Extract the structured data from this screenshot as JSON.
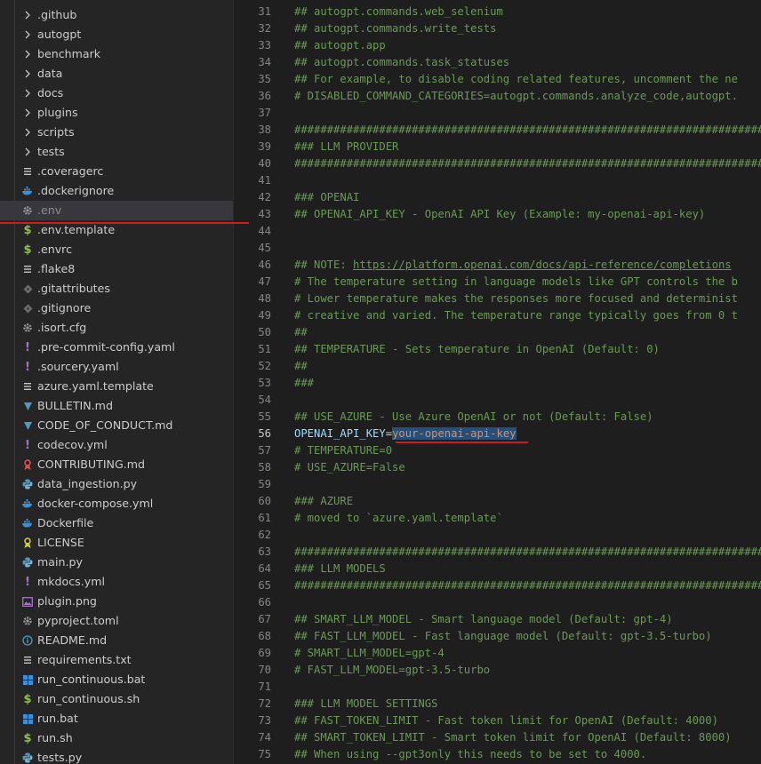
{
  "explorer": {
    "items": [
      {
        "label": ".github",
        "kind": "folder",
        "icon": "chevron-right-icon"
      },
      {
        "label": "autogpt",
        "kind": "folder",
        "icon": "chevron-right-icon"
      },
      {
        "label": "benchmark",
        "kind": "folder",
        "icon": "chevron-right-icon"
      },
      {
        "label": "data",
        "kind": "folder",
        "icon": "chevron-right-icon"
      },
      {
        "label": "docs",
        "kind": "folder",
        "icon": "chevron-right-icon"
      },
      {
        "label": "plugins",
        "kind": "folder",
        "icon": "chevron-right-icon"
      },
      {
        "label": "scripts",
        "kind": "folder",
        "icon": "chevron-right-icon"
      },
      {
        "label": "tests",
        "kind": "folder",
        "icon": "chevron-right-icon"
      },
      {
        "label": ".coveragerc",
        "kind": "file",
        "icon": "lines-icon"
      },
      {
        "label": ".dockerignore",
        "kind": "file",
        "icon": "docker-icon"
      },
      {
        "label": ".env",
        "kind": "file",
        "icon": "gear-icon",
        "selected": true
      },
      {
        "label": ".env.template",
        "kind": "file",
        "icon": "dollar-icon"
      },
      {
        "label": ".envrc",
        "kind": "file",
        "icon": "dollar-icon"
      },
      {
        "label": ".flake8",
        "kind": "file",
        "icon": "lines-icon"
      },
      {
        "label": ".gitattributes",
        "kind": "file",
        "icon": "git-icon"
      },
      {
        "label": ".gitignore",
        "kind": "file",
        "icon": "git-icon"
      },
      {
        "label": ".isort.cfg",
        "kind": "file",
        "icon": "gear-icon"
      },
      {
        "label": ".pre-commit-config.yaml",
        "kind": "file",
        "icon": "exclamation-icon"
      },
      {
        "label": ".sourcery.yaml",
        "kind": "file",
        "icon": "exclamation-icon"
      },
      {
        "label": "azure.yaml.template",
        "kind": "file",
        "icon": "lines-icon"
      },
      {
        "label": "BULLETIN.md",
        "kind": "file",
        "icon": "markdown-icon"
      },
      {
        "label": "CODE_OF_CONDUCT.md",
        "kind": "file",
        "icon": "markdown-icon"
      },
      {
        "label": "codecov.yml",
        "kind": "file",
        "icon": "exclamation-icon"
      },
      {
        "label": "CONTRIBUTING.md",
        "kind": "file",
        "icon": "ribbon-icon"
      },
      {
        "label": "data_ingestion.py",
        "kind": "file",
        "icon": "python-icon"
      },
      {
        "label": "docker-compose.yml",
        "kind": "file",
        "icon": "docker-icon"
      },
      {
        "label": "Dockerfile",
        "kind": "file",
        "icon": "docker-icon"
      },
      {
        "label": "LICENSE",
        "kind": "file",
        "icon": "license-icon"
      },
      {
        "label": "main.py",
        "kind": "file",
        "icon": "python-icon"
      },
      {
        "label": "mkdocs.yml",
        "kind": "file",
        "icon": "exclamation-icon"
      },
      {
        "label": "plugin.png",
        "kind": "file",
        "icon": "image-icon"
      },
      {
        "label": "pyproject.toml",
        "kind": "file",
        "icon": "gear-icon"
      },
      {
        "label": "README.md",
        "kind": "file",
        "icon": "info-icon"
      },
      {
        "label": "requirements.txt",
        "kind": "file",
        "icon": "lines-icon"
      },
      {
        "label": "run_continuous.bat",
        "kind": "file",
        "icon": "windows-icon"
      },
      {
        "label": "run_continuous.sh",
        "kind": "file",
        "icon": "dollar-icon"
      },
      {
        "label": "run.bat",
        "kind": "file",
        "icon": "windows-icon"
      },
      {
        "label": "run.sh",
        "kind": "file",
        "icon": "dollar-icon"
      },
      {
        "label": "tests.py",
        "kind": "file",
        "icon": "python-icon"
      }
    ]
  },
  "editor": {
    "active_line": 56,
    "lines": [
      {
        "n": "31",
        "text": "## autogpt.commands.web_selenium"
      },
      {
        "n": "32",
        "text": "## autogpt.commands.write_tests"
      },
      {
        "n": "33",
        "text": "## autogpt.app"
      },
      {
        "n": "34",
        "text": "## autogpt.commands.task_statuses"
      },
      {
        "n": "35",
        "text": "## For example, to disable coding related features, uncomment the ne"
      },
      {
        "n": "36",
        "text": "# DISABLED_COMMAND_CATEGORIES=autogpt.commands.analyze_code,autogpt."
      },
      {
        "n": "37",
        "text": ""
      },
      {
        "n": "38",
        "text": "################################################################################"
      },
      {
        "n": "39",
        "text": "### LLM PROVIDER"
      },
      {
        "n": "40",
        "text": "################################################################################"
      },
      {
        "n": "41",
        "text": ""
      },
      {
        "n": "42",
        "text": "### OPENAI"
      },
      {
        "n": "43",
        "text": "## OPENAI_API_KEY - OpenAI API Key (Example: my-openai-api-key)"
      },
      {
        "n": "44",
        "text": ""
      },
      {
        "n": "45",
        "text": ""
      },
      {
        "n": "46",
        "pre": "## NOTE: ",
        "link": "https://platform.openai.com/docs/api-reference/completions"
      },
      {
        "n": "47",
        "text": "# The temperature setting in language models like GPT controls the b"
      },
      {
        "n": "48",
        "text": "# Lower temperature makes the responses more focused and determinist"
      },
      {
        "n": "49",
        "text": "# creative and varied. The temperature range typically goes from 0 t"
      },
      {
        "n": "50",
        "text": "##"
      },
      {
        "n": "51",
        "text": "## TEMPERATURE - Sets temperature in OpenAI (Default: 0)"
      },
      {
        "n": "52",
        "text": "##"
      },
      {
        "n": "53",
        "text": "###"
      },
      {
        "n": "54",
        "text": ""
      },
      {
        "n": "55",
        "text": "## USE_AZURE - Use Azure OpenAI or not (Default: False)"
      },
      {
        "n": "56",
        "key": "OPENAI_API_KEY",
        "op": "=",
        "value": "your-openai-api-key"
      },
      {
        "n": "57",
        "text": "# TEMPERATURE=0"
      },
      {
        "n": "58",
        "text": "# USE_AZURE=False"
      },
      {
        "n": "59",
        "text": ""
      },
      {
        "n": "60",
        "text": "### AZURE"
      },
      {
        "n": "61",
        "text": "# moved to `azure.yaml.template`"
      },
      {
        "n": "62",
        "text": ""
      },
      {
        "n": "63",
        "text": "################################################################################"
      },
      {
        "n": "64",
        "text": "### LLM MODELS"
      },
      {
        "n": "65",
        "text": "################################################################################"
      },
      {
        "n": "66",
        "text": ""
      },
      {
        "n": "67",
        "text": "## SMART_LLM_MODEL - Smart language model (Default: gpt-4)"
      },
      {
        "n": "68",
        "text": "## FAST_LLM_MODEL - Fast language model (Default: gpt-3.5-turbo)"
      },
      {
        "n": "69",
        "text": "# SMART_LLM_MODEL=gpt-4"
      },
      {
        "n": "70",
        "text": "# FAST_LLM_MODEL=gpt-3.5-turbo"
      },
      {
        "n": "71",
        "text": ""
      },
      {
        "n": "72",
        "text": "### LLM MODEL SETTINGS"
      },
      {
        "n": "73",
        "text": "## FAST_TOKEN_LIMIT - Fast token limit for OpenAI (Default: 4000)"
      },
      {
        "n": "74",
        "text": "## SMART_TOKEN_LIMIT - Smart token limit for OpenAI (Default: 8000)"
      },
      {
        "n": "75",
        "text": "## When using --gpt3only this needs to be set to 4000."
      }
    ]
  },
  "colors": {
    "comment": "#6a9955",
    "key": "#9cdcfe",
    "selection": "#264f78",
    "annotation": "#d01c1c",
    "sidebar": "#252526",
    "editor": "#1e1e1e"
  }
}
